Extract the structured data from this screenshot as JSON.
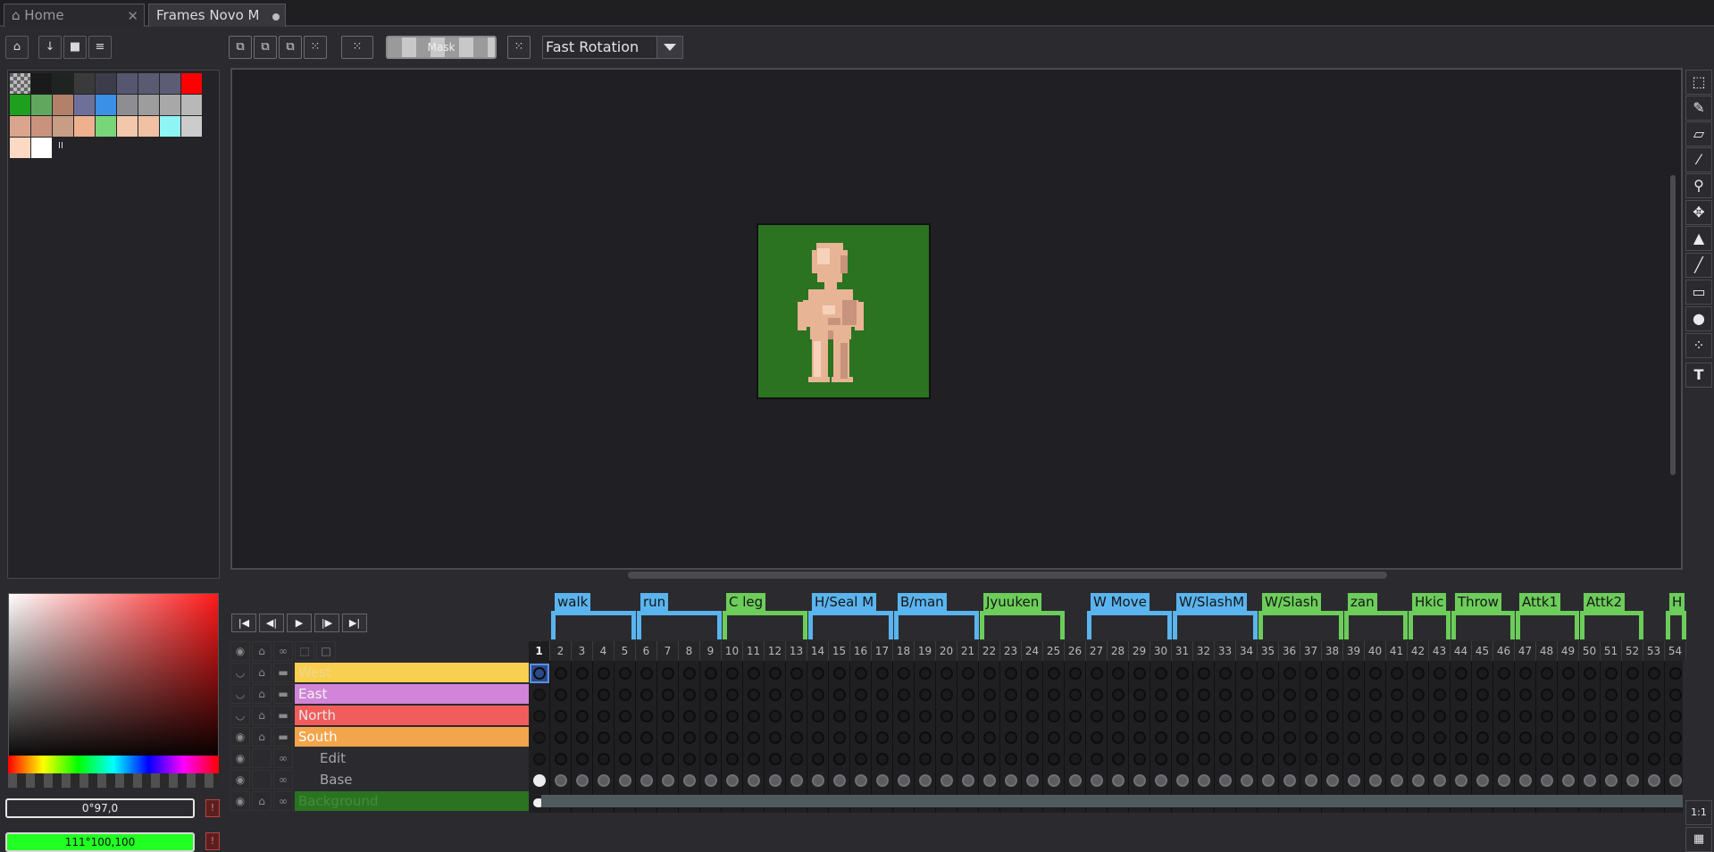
{
  "tabs": [
    {
      "label": "Home",
      "close": "✕"
    },
    {
      "label": "Frames Novo M"
    }
  ],
  "toolbar": {
    "mask_label": "Mask",
    "rotation_value": "Fast Rotation"
  },
  "palette": {
    "colors": [
      "#c7c7c7",
      "#1a1a1a",
      "#202420",
      "#3a3a3a",
      "#3c3c4a",
      "#565670",
      "#5a5a72",
      "#5c5c74",
      "#ff0000",
      "#1ea01e",
      "#61a75d",
      "#b3806a",
      "#6f7099",
      "#3a8fe6",
      "#8e8e92",
      "#9d9d9d",
      "#a8a8a8",
      "#b8b8b8",
      "#d9a58c",
      "#c9927c",
      "#c89d86",
      "#efb090",
      "#78d678",
      "#f2c7aa",
      "#f1c1a3",
      "#8ff4f4",
      "#cccccc",
      "#fcd9c3",
      "#ffffff"
    ],
    "menu_glyph": "II"
  },
  "colors_panel": {
    "fg_value": "0°97,0",
    "bg_value": "111°100,100",
    "fg_color": "#000000",
    "bg_color": "#22ff22"
  },
  "timeline": {
    "tags": [
      {
        "label": "walk",
        "color": "#5ab4ee",
        "from": 2,
        "to": 5
      },
      {
        "label": "run",
        "color": "#5ab4ee",
        "from": 6,
        "to": 9
      },
      {
        "label": "C leg",
        "color": "#6ccd5a",
        "from": 10,
        "to": 13
      },
      {
        "label": "H/Seal M",
        "color": "#5ab4ee",
        "from": 14,
        "to": 17
      },
      {
        "label": "B/man",
        "color": "#5ab4ee",
        "from": 18,
        "to": 21
      },
      {
        "label": "Jyuuken",
        "color": "#6ccd5a",
        "from": 22,
        "to": 25
      },
      {
        "label": "W Move",
        "color": "#5ab4ee",
        "from": 27,
        "to": 30
      },
      {
        "label": "W/SlashM",
        "color": "#5ab4ee",
        "from": 31,
        "to": 34
      },
      {
        "label": "W/Slash",
        "color": "#6ccd5a",
        "from": 35,
        "to": 38
      },
      {
        "label": "zan",
        "color": "#6ccd5a",
        "from": 39,
        "to": 41
      },
      {
        "label": "Hkic",
        "color": "#6ccd5a",
        "from": 42,
        "to": 43
      },
      {
        "label": "Throw",
        "color": "#6ccd5a",
        "from": 44,
        "to": 46
      },
      {
        "label": "Attk1",
        "color": "#6ccd5a",
        "from": 47,
        "to": 49
      },
      {
        "label": "Attk2",
        "color": "#6ccd5a",
        "from": 50,
        "to": 52
      },
      {
        "label": "H",
        "color": "#6ccd5a",
        "from": 54,
        "to": 54
      }
    ],
    "frame_count": 54,
    "current_frame": 1,
    "layers": [
      {
        "name": "West",
        "color": "#f9cf50",
        "text_color": "#f0d88a",
        "kind": "group"
      },
      {
        "name": "East",
        "color": "#d184d8",
        "text_color": "#f2f2f2",
        "kind": "group"
      },
      {
        "name": "North",
        "color": "#f25c5c",
        "text_color": "#e8e8e8",
        "kind": "group"
      },
      {
        "name": "South",
        "color": "#f3a54b",
        "text_color": "#ffffff",
        "kind": "group"
      },
      {
        "name": "Edit",
        "color": "",
        "text_color": "#a6a6a6",
        "kind": "child"
      },
      {
        "name": "Base",
        "color": "",
        "text_color": "#a6a6a6",
        "kind": "child"
      },
      {
        "name": "Background",
        "color": "#2b7320",
        "text_color": "#3f8f3a",
        "kind": "layer"
      }
    ]
  },
  "zoom": {
    "label": "1:1"
  }
}
